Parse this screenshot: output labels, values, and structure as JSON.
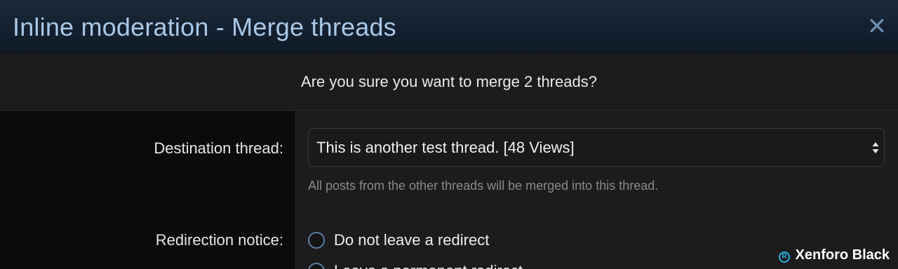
{
  "dialog": {
    "title": "Inline moderation - Merge threads",
    "close_glyph": "✕",
    "confirm_text": "Are you sure you want to merge 2 threads?"
  },
  "form": {
    "destination": {
      "label": "Destination thread:",
      "selected": "This is another test thread. [48 Views]",
      "hint": "All posts from the other threads will be merged into this thread."
    },
    "redirect": {
      "label": "Redirection notice:",
      "options": [
        {
          "label": "Do not leave a redirect",
          "checked": false
        },
        {
          "label": "Leave a permanent redirect",
          "checked": true
        }
      ]
    }
  },
  "watermark": {
    "mark": "R",
    "text": "Xenforo Black"
  },
  "colors": {
    "accent": "#5b7fa4",
    "title": "#a9c7e6",
    "header_bg": "#142030",
    "panel_bg": "#1c1c1d",
    "label_col_bg": "#0b0b0b"
  },
  "icons": [
    "close-icon",
    "select-arrows-icon",
    "radio-icon",
    "watermark-logo-icon"
  ]
}
